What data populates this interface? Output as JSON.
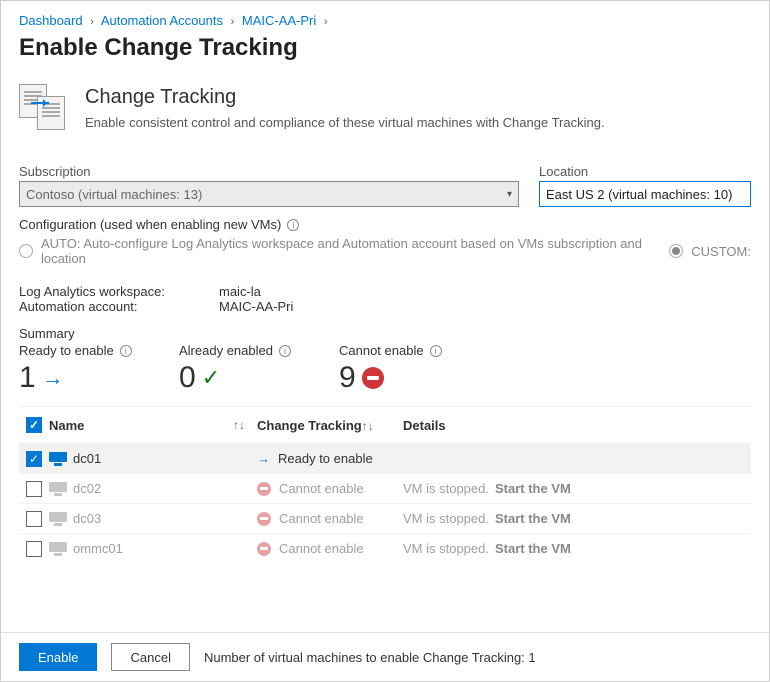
{
  "breadcrumb": {
    "items": [
      "Dashboard",
      "Automation Accounts",
      "MAIC-AA-Pri"
    ],
    "sep": "›"
  },
  "page_title": "Enable Change Tracking",
  "hero": {
    "title": "Change Tracking",
    "subtitle": "Enable consistent control and compliance of these virtual machines with Change Tracking."
  },
  "fields": {
    "subscription_label": "Subscription",
    "subscription_value": "Contoso (virtual machines: 13)",
    "location_label": "Location",
    "location_value": "East US 2 (virtual machines: 10)"
  },
  "config": {
    "title": "Configuration (used when enabling new VMs)",
    "auto_label": "AUTO: Auto-configure Log Analytics workspace and Automation account based on VMs subscription and location",
    "custom_label": "CUSTOM:"
  },
  "info": {
    "la_workspace_label": "Log Analytics workspace:",
    "la_workspace_value": "maic-la",
    "automation_label": "Automation account:",
    "automation_value": "MAIC-AA-Pri"
  },
  "summary": {
    "title": "Summary",
    "ready_label": "Ready to enable",
    "ready_value": "1",
    "already_label": "Already enabled",
    "already_value": "0",
    "cannot_label": "Cannot enable",
    "cannot_value": "9"
  },
  "table": {
    "headers": {
      "name": "Name",
      "ct": "Change Tracking",
      "details": "Details"
    },
    "rows": [
      {
        "selected": true,
        "selectable": true,
        "name": "dc01",
        "status": "ready",
        "status_text": "Ready to enable",
        "details": "",
        "action": ""
      },
      {
        "selected": false,
        "selectable": false,
        "name": "dc02",
        "status": "cannot",
        "status_text": "Cannot enable",
        "details": "VM is stopped.",
        "action": "Start the VM"
      },
      {
        "selected": false,
        "selectable": false,
        "name": "dc03",
        "status": "cannot",
        "status_text": "Cannot enable",
        "details": "VM is stopped.",
        "action": "Start the VM"
      },
      {
        "selected": false,
        "selectable": false,
        "name": "ommc01",
        "status": "cannot",
        "status_text": "Cannot enable",
        "details": "VM is stopped.",
        "action": "Start the VM"
      }
    ]
  },
  "footer": {
    "enable": "Enable",
    "cancel": "Cancel",
    "message": "Number of virtual machines to enable Change Tracking: 1"
  }
}
